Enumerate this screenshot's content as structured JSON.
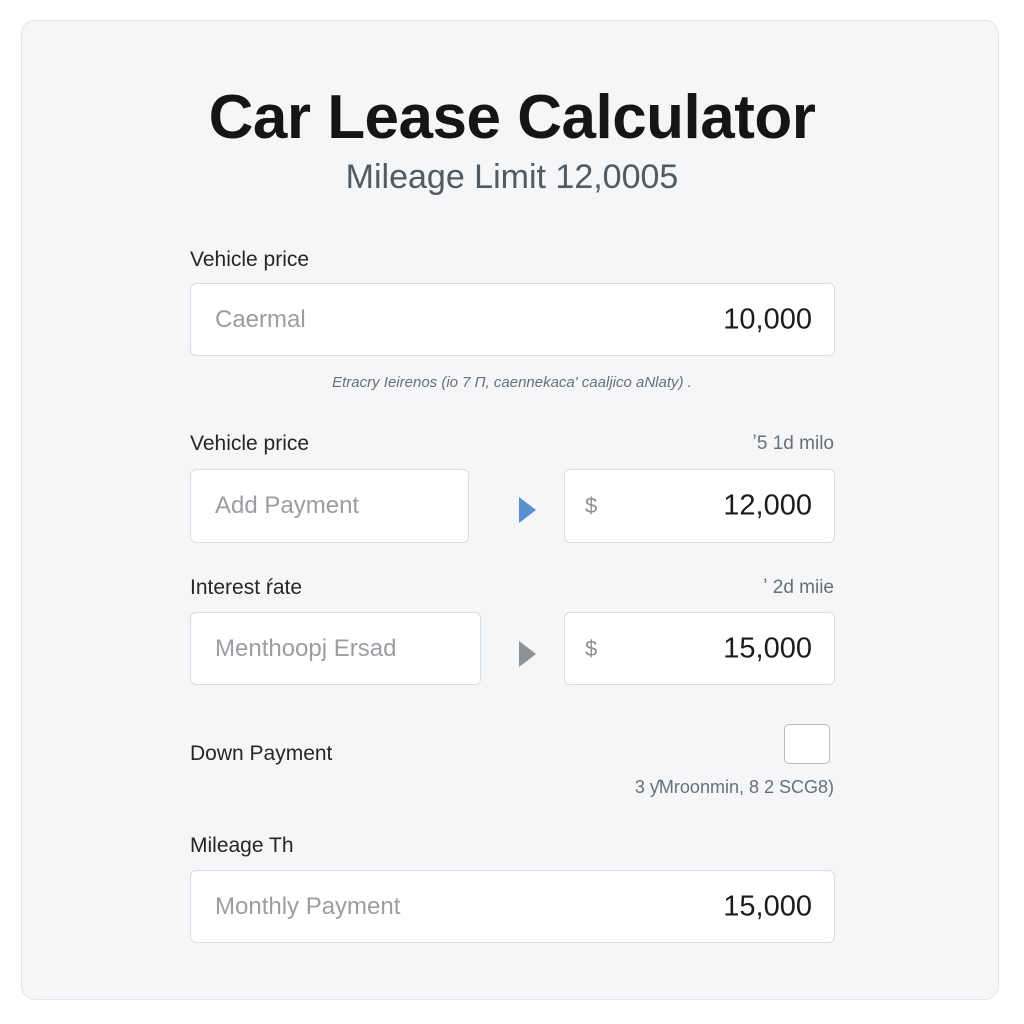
{
  "header": {
    "title": "Car Lease Calculator",
    "subtitle": "Mileage Limit 12,0005"
  },
  "vehicle_price": {
    "label": "Vehicle price",
    "placeholder": "Caermal",
    "value": "10,000",
    "note": "Etracry Ieirenos (io 7 Π, caennekaca' caaljico aNlaty) ."
  },
  "payment_row": {
    "label": "Vehicle price",
    "hint": "ʼ5 1d milo",
    "left_placeholder": "Add Payment",
    "currency_symbol": "$",
    "value": "12,000"
  },
  "interest_row": {
    "label": "Interest ŕate",
    "hint": "ʼ 2d miie",
    "left_placeholder": "Menthoopj Ersad",
    "currency_symbol": "$",
    "value": "15,000"
  },
  "down_payment": {
    "label": "Down Payment",
    "checked": false,
    "note": "3 ƴMroonmin, 8 2 SCG8)"
  },
  "mileage": {
    "label": "Mileage Th",
    "placeholder": "Monthly Payment",
    "value": "15,000"
  },
  "colors": {
    "card_background": "#f5f6f7",
    "field_background": "#ffffff",
    "field_border": "#d9dce0",
    "arrow_active": "#5b8fd0",
    "arrow_inactive": "#8e9296"
  },
  "icons": {
    "payment_arrow": "triangle-right-icon",
    "interest_arrow": "triangle-right-icon"
  }
}
